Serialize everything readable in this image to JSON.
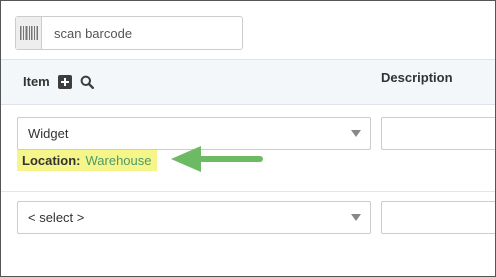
{
  "scan": {
    "placeholder": "scan barcode",
    "icon": "barcode-icon"
  },
  "table": {
    "headers": {
      "item": "Item",
      "description": "Description"
    },
    "header_icons": [
      "plus-square-icon",
      "search-icon"
    ],
    "rows": [
      {
        "item_value": "Widget",
        "location_label": "Location:",
        "location_value": "Warehouse"
      },
      {
        "item_value": "< select >"
      }
    ]
  },
  "annotation": {
    "arrow_icon": "green-arrow-icon",
    "highlight_color": "#f6f58a",
    "arrow_color": "#6cba63"
  }
}
